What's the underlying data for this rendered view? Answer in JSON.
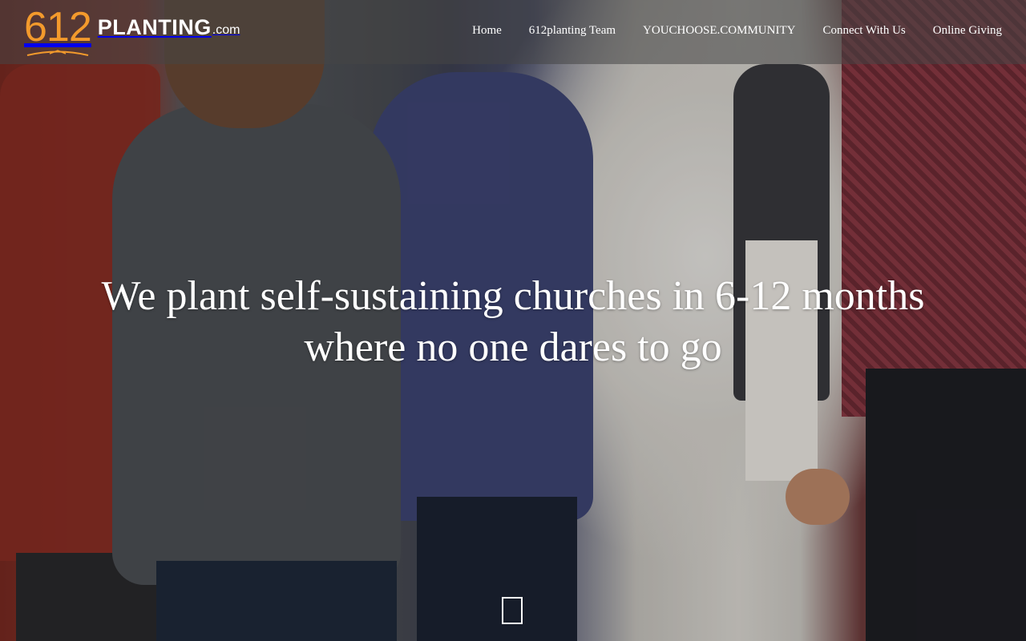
{
  "logo": {
    "number": "612",
    "word": "PLANTING",
    "suffix": ".com"
  },
  "nav": {
    "items": [
      {
        "label": "Home"
      },
      {
        "label": "612planting Team"
      },
      {
        "label": "YOUCHOOSE.COMMUNITY"
      },
      {
        "label": "Connect With Us"
      },
      {
        "label": "Online Giving"
      }
    ]
  },
  "hero": {
    "line1": "We plant self-sustaining churches in 6-12 months",
    "line2": "where no one dares to go"
  },
  "colors": {
    "brand_orange": "#f39a2c",
    "header_overlay": "rgba(70,70,70,0.55)",
    "text": "#ffffff"
  },
  "icons": {
    "scroll_indicator": "square-outline-icon"
  }
}
